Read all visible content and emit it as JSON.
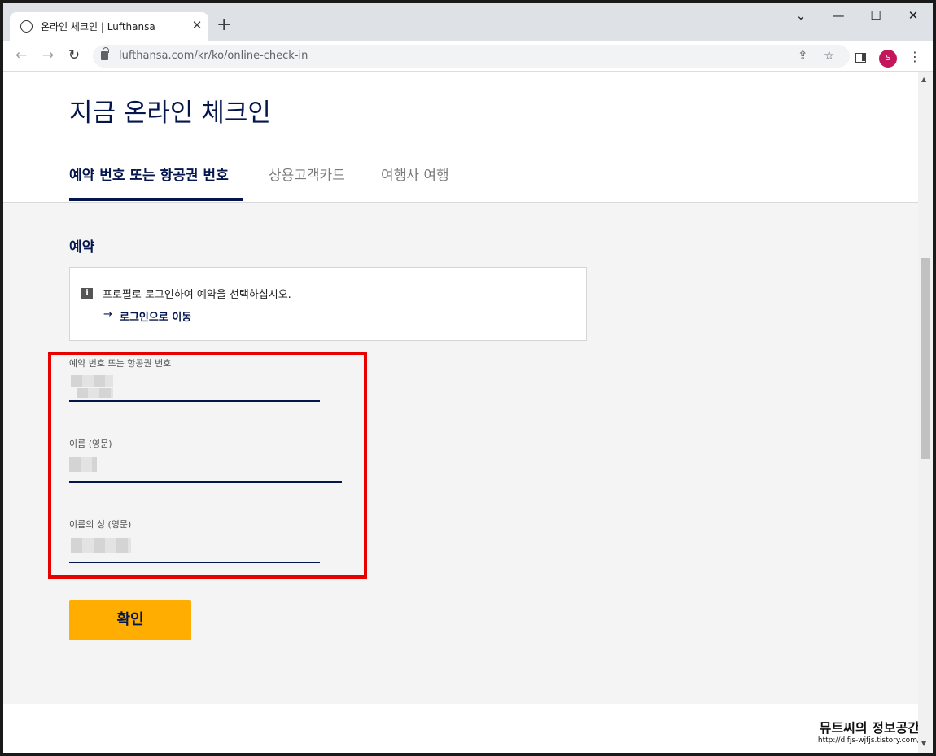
{
  "browser": {
    "tab_title": "온라인 체크인 | Lufthansa",
    "tab_close": "✕",
    "new_tab": "+",
    "url": "lufthansa.com/kr/ko/online-check-in",
    "avatar_letter": "S",
    "window_controls": [
      "⌄",
      "—",
      "☐",
      "✕"
    ]
  },
  "page": {
    "title": "지금 온라인 체크인",
    "tabs": [
      {
        "label": "예약 번호 또는 항공권 번호",
        "active": true
      },
      {
        "label": "상용고객카드",
        "active": false
      },
      {
        "label": "여행사 여행",
        "active": false
      }
    ],
    "section_heading": "예약",
    "info": {
      "icon": "i",
      "text": "프로필로 로그인하여 예약을 선택하십시오.",
      "link_arrow": "→",
      "link": "로그인으로 이동"
    },
    "fields": [
      {
        "label": "예약 번호 또는 항공권 번호",
        "value": ""
      },
      {
        "label": "이름 (영문)",
        "value": ""
      },
      {
        "label": "이름의 성 (영문)",
        "value": ""
      }
    ],
    "confirm_button": "확인"
  },
  "watermark": {
    "title": "뮤트씨의 정보공간",
    "url": "http://dlfjs-wjfjs.tistory.com/"
  },
  "colors": {
    "brand_navy": "#05164d",
    "button_yellow": "#ffad00",
    "highlight_red": "#e60000"
  }
}
